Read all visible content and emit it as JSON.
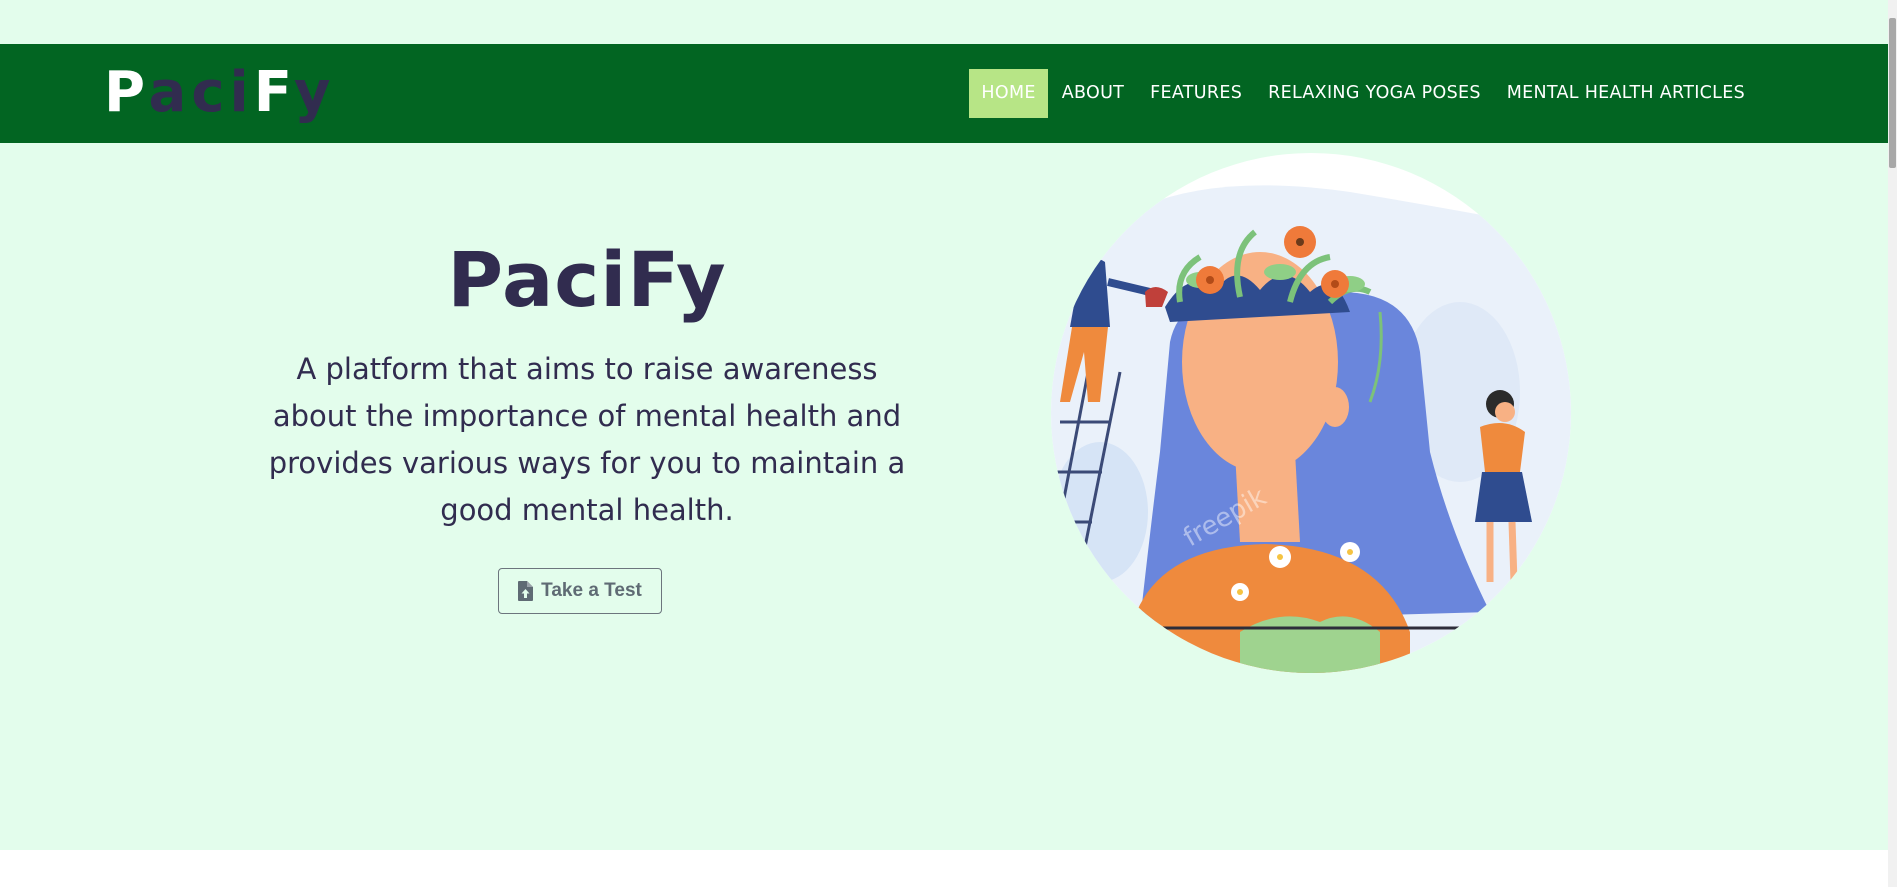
{
  "brand": {
    "letters": [
      {
        "ch": "P",
        "tone": "light"
      },
      {
        "ch": "a",
        "tone": "dark"
      },
      {
        "ch": "c",
        "tone": "dark"
      },
      {
        "ch": "i",
        "tone": "dark"
      },
      {
        "ch": "F",
        "tone": "light"
      },
      {
        "ch": "y",
        "tone": "dark"
      }
    ]
  },
  "nav": {
    "home": "HOME",
    "about": "ABOUT",
    "features": "FEATURES",
    "yoga": "RELAXING YOGA POSES",
    "articles": "MENTAL HEALTH ARTICLES"
  },
  "hero": {
    "title": "PaciFy",
    "description": "A platform that aims to raise awareness about the importance of mental health and provides various ways for you to maintain a good mental health.",
    "button_label": "Take a Test",
    "image_watermark": "freepik"
  },
  "colors": {
    "navbar": "#026522",
    "active_nav": "#b7e586",
    "page_background": "#e3fdec",
    "heading": "#312c4f"
  },
  "icons": {
    "button": "file-upload-icon"
  }
}
